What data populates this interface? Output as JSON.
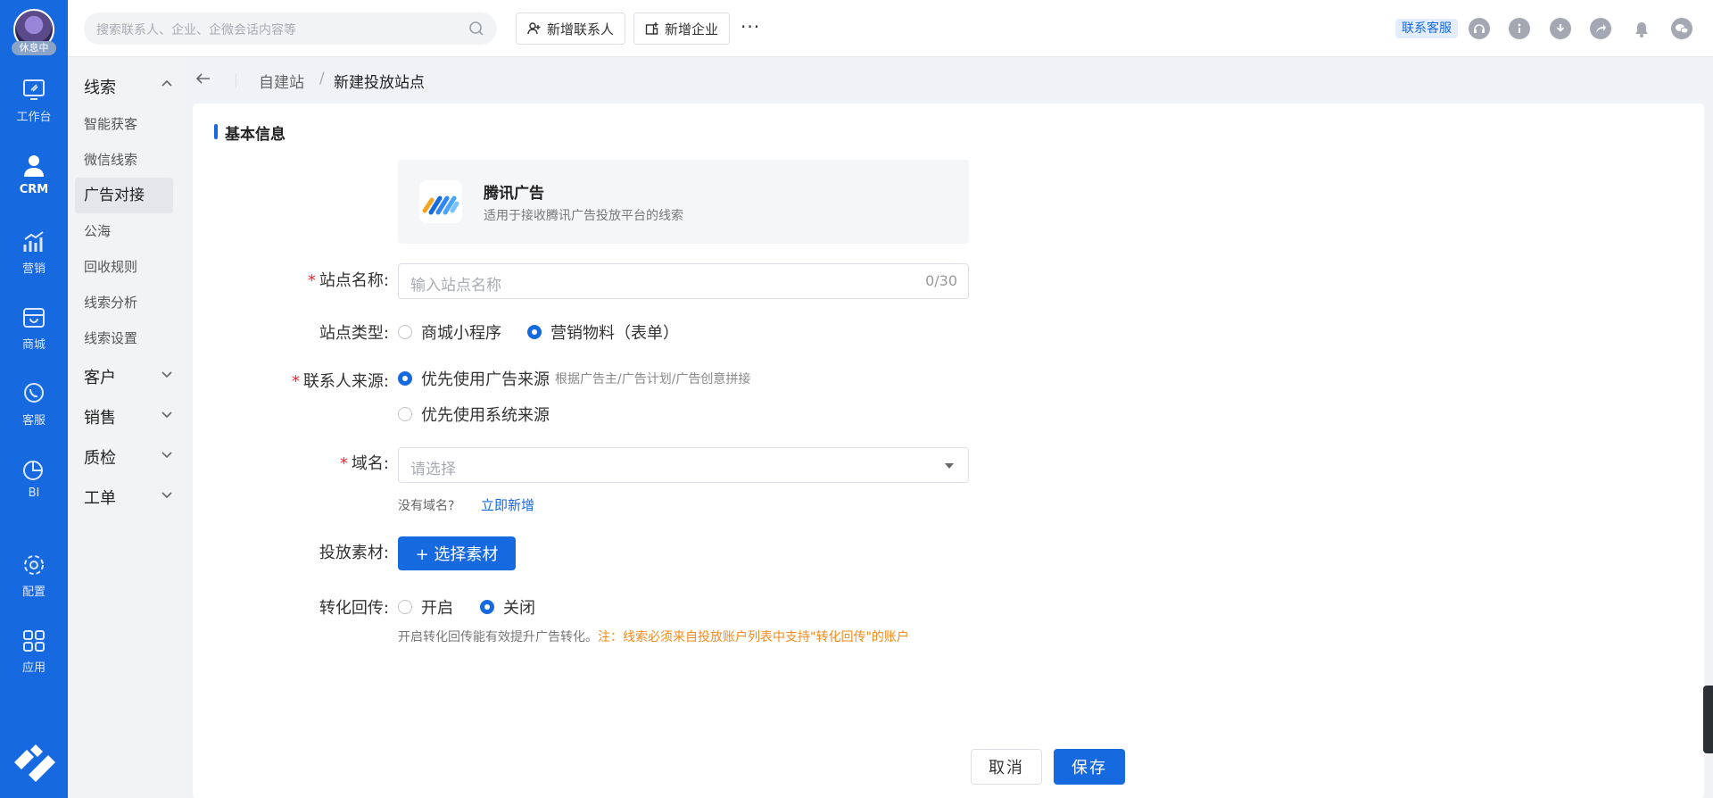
{
  "user": {
    "status": "休息中"
  },
  "rail": {
    "items": [
      {
        "label": "工作台",
        "icon": "workbench-icon"
      },
      {
        "label": "CRM",
        "icon": "person-icon"
      },
      {
        "label": "营销",
        "icon": "marketing-chart-icon"
      },
      {
        "label": "商城",
        "icon": "store-icon"
      },
      {
        "label": "客服",
        "icon": "chat-phone-icon"
      },
      {
        "label": "BI",
        "icon": "pie-chart-icon"
      },
      {
        "label": "配置",
        "icon": "gear-icon"
      },
      {
        "label": "应用",
        "icon": "apps-grid-icon"
      }
    ]
  },
  "topbar": {
    "search_placeholder": "搜索联系人、企业、企微会话内容等",
    "add_contact": "新增联系人",
    "add_company": "新增企业",
    "more": "···",
    "contact_service": "联系客服"
  },
  "subnav": {
    "groups": {
      "leads": "线索",
      "customers": "客户",
      "sales": "销售",
      "qc": "质检",
      "tickets": "工单"
    },
    "lead_items": [
      "智能获客",
      "微信线索",
      "广告对接",
      "公海",
      "回收规则",
      "线索分析",
      "线索设置"
    ]
  },
  "breadcrumb": {
    "parent": "自建站",
    "sep": "/",
    "current": "新建投放站点"
  },
  "form": {
    "section_title": "基本信息",
    "platform": {
      "name": "腾讯广告",
      "desc": "适用于接收腾讯广告投放平台的线索"
    },
    "site_name": {
      "label": "站点名称:",
      "placeholder": "输入站点名称",
      "count": "0/30"
    },
    "site_type": {
      "label": "站点类型:",
      "options": [
        "商城小程序",
        "营销物料（表单）"
      ],
      "selected": 1
    },
    "contact_source": {
      "label": "联系人来源:",
      "options": [
        "优先使用广告来源",
        "优先使用系统来源"
      ],
      "hint": "根据广告主/广告计划/广告创意拼接",
      "selected": 0
    },
    "domain": {
      "label": "域名:",
      "placeholder": "请选择",
      "no_domain": "没有域名?",
      "add_now": "立即新增"
    },
    "material": {
      "label": "投放素材:",
      "button": "+ 选择素材"
    },
    "conversion": {
      "label": "转化回传:",
      "options": [
        "开启",
        "关闭"
      ],
      "selected": 1,
      "note": "开启转化回传能有效提升广告转化。",
      "warning": "注：线索必须来自投放账户列表中支持\"转化回传\"的账户"
    }
  },
  "actions": {
    "cancel": "取消",
    "save": "保存"
  },
  "colors": {
    "accent": "#1769e0",
    "warning": "#f28b1e",
    "required": "#f5222d"
  }
}
